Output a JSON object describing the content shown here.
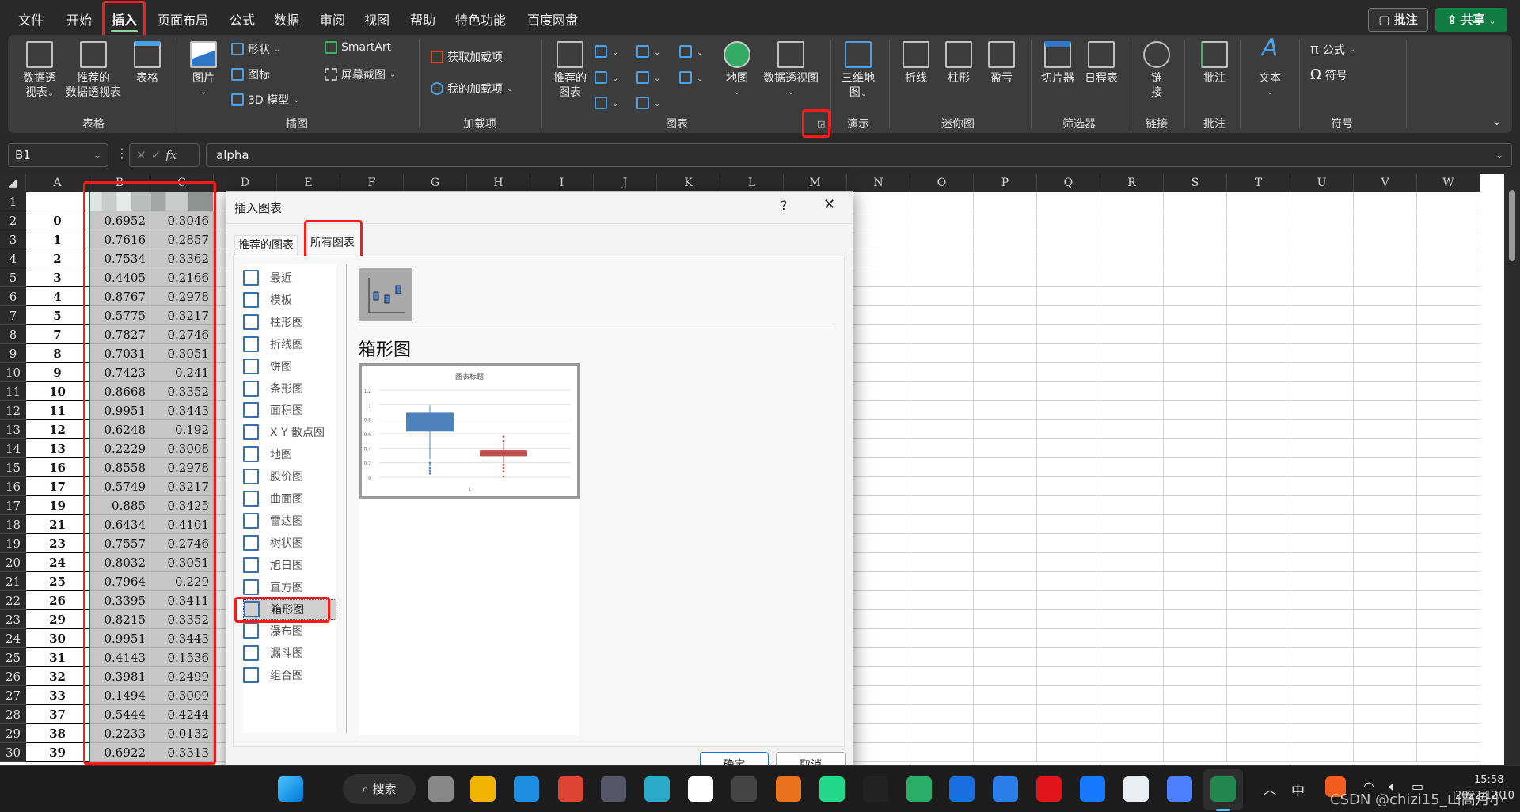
{
  "menu": {
    "tabs": [
      "文件",
      "开始",
      "插入",
      "页面布局",
      "公式",
      "数据",
      "审阅",
      "视图",
      "帮助",
      "特色功能",
      "百度网盘"
    ],
    "active": "插入",
    "comment_button": "批注",
    "share_button": "共享"
  },
  "ribbon": {
    "groups": {
      "table": "表格",
      "illustrations": "插图",
      "addins": "加载项",
      "charts": "图表",
      "tours": "演示",
      "sparklines": "迷你图",
      "filters": "筛选器",
      "links": "链接",
      "comments": "批注",
      "symbols": "符号"
    },
    "pivot_table": [
      "数据透",
      "视表"
    ],
    "recommended_pivot": [
      "推荐的",
      "数据透视表"
    ],
    "table": "表格",
    "pictures": "图片",
    "shapes": "形状",
    "icons": "图标",
    "models_3d": "3D 模型",
    "smartart": "SmartArt",
    "screenshot": "屏幕截图",
    "get_addins": "获取加载项",
    "my_addins": "我的加载项",
    "recommended_charts": [
      "推荐的",
      "图表"
    ],
    "maps": "地图",
    "pivot_chart": "数据透视图",
    "map_3d": [
      "三维地",
      "图"
    ],
    "spark_line": "折线",
    "spark_column": "柱形",
    "spark_winloss": "盈亏",
    "slicer": "切片器",
    "timeline": "日程表",
    "link": [
      "链",
      "接"
    ],
    "comment": "批注",
    "text": "文本",
    "equation": "公式",
    "symbol": "符号"
  },
  "formula_bar": {
    "name_box": "B1",
    "fx": "fx",
    "value": "alpha"
  },
  "sheet": {
    "columns": [
      "A",
      "B",
      "C",
      "D",
      "E",
      "F",
      "G",
      "H",
      "I",
      "J",
      "K",
      "L",
      "M",
      "N",
      "O",
      "P",
      "Q",
      "R",
      "S",
      "T",
      "U",
      "V",
      "W"
    ],
    "rows": [
      [
        "0",
        "0.6952",
        "0.3046"
      ],
      [
        "1",
        "0.7616",
        "0.2857"
      ],
      [
        "2",
        "0.7534",
        "0.3362"
      ],
      [
        "3",
        "0.4405",
        "0.2166"
      ],
      [
        "4",
        "0.8767",
        "0.2978"
      ],
      [
        "5",
        "0.5775",
        "0.3217"
      ],
      [
        "7",
        "0.7827",
        "0.2746"
      ],
      [
        "8",
        "0.7031",
        "0.3051"
      ],
      [
        "9",
        "0.7423",
        "0.241"
      ],
      [
        "10",
        "0.8668",
        "0.3352"
      ],
      [
        "11",
        "0.9951",
        "0.3443"
      ],
      [
        "12",
        "0.6248",
        "0.192"
      ],
      [
        "13",
        "0.2229",
        "0.3008"
      ],
      [
        "16",
        "0.8558",
        "0.2978"
      ],
      [
        "17",
        "0.5749",
        "0.3217"
      ],
      [
        "19",
        "0.885",
        "0.3425"
      ],
      [
        "21",
        "0.6434",
        "0.4101"
      ],
      [
        "23",
        "0.7557",
        "0.2746"
      ],
      [
        "24",
        "0.8032",
        "0.3051"
      ],
      [
        "25",
        "0.7964",
        "0.229"
      ],
      [
        "26",
        "0.3395",
        "0.3411"
      ],
      [
        "29",
        "0.8215",
        "0.3352"
      ],
      [
        "30",
        "0.9951",
        "0.3443"
      ],
      [
        "31",
        "0.4143",
        "0.1536"
      ],
      [
        "32",
        "0.3981",
        "0.2499"
      ],
      [
        "33",
        "0.1494",
        "0.3009"
      ],
      [
        "37",
        "0.5444",
        "0.4244"
      ],
      [
        "38",
        "0.2233",
        "0.0132"
      ],
      [
        "39",
        "0.6922",
        "0.3313"
      ]
    ]
  },
  "dialog": {
    "title": "插入图表",
    "help": "?",
    "close": "✕",
    "tabs": [
      "推荐的图表",
      "所有图表"
    ],
    "active_tab": "所有图表",
    "chart_types": [
      "最近",
      "模板",
      "柱形图",
      "折线图",
      "饼图",
      "条形图",
      "面积图",
      "X Y 散点图",
      "地图",
      "股价图",
      "曲面图",
      "雷达图",
      "树状图",
      "旭日图",
      "直方图",
      "箱形图",
      "瀑布图",
      "漏斗图",
      "组合图"
    ],
    "selected_type": "箱形图",
    "heading": "箱形图",
    "preview": {
      "title": "图表标题",
      "y_ticks": [
        "0",
        "0.2",
        "0.4",
        "0.6",
        "0.8",
        "1",
        "1.2"
      ],
      "x_label": "1"
    },
    "ok": "确定",
    "cancel": "取消"
  },
  "taskbar": {
    "search": "搜索",
    "ime": "中",
    "time": "15:58",
    "date": "2022/12/10",
    "watermark": "CSDN @chizi15_山高月小"
  },
  "colors": {
    "accent_green": "#107c41",
    "highlight_red": "#ff1a1a",
    "box_blue": "#4f81bd",
    "box_red": "#c0504d"
  }
}
